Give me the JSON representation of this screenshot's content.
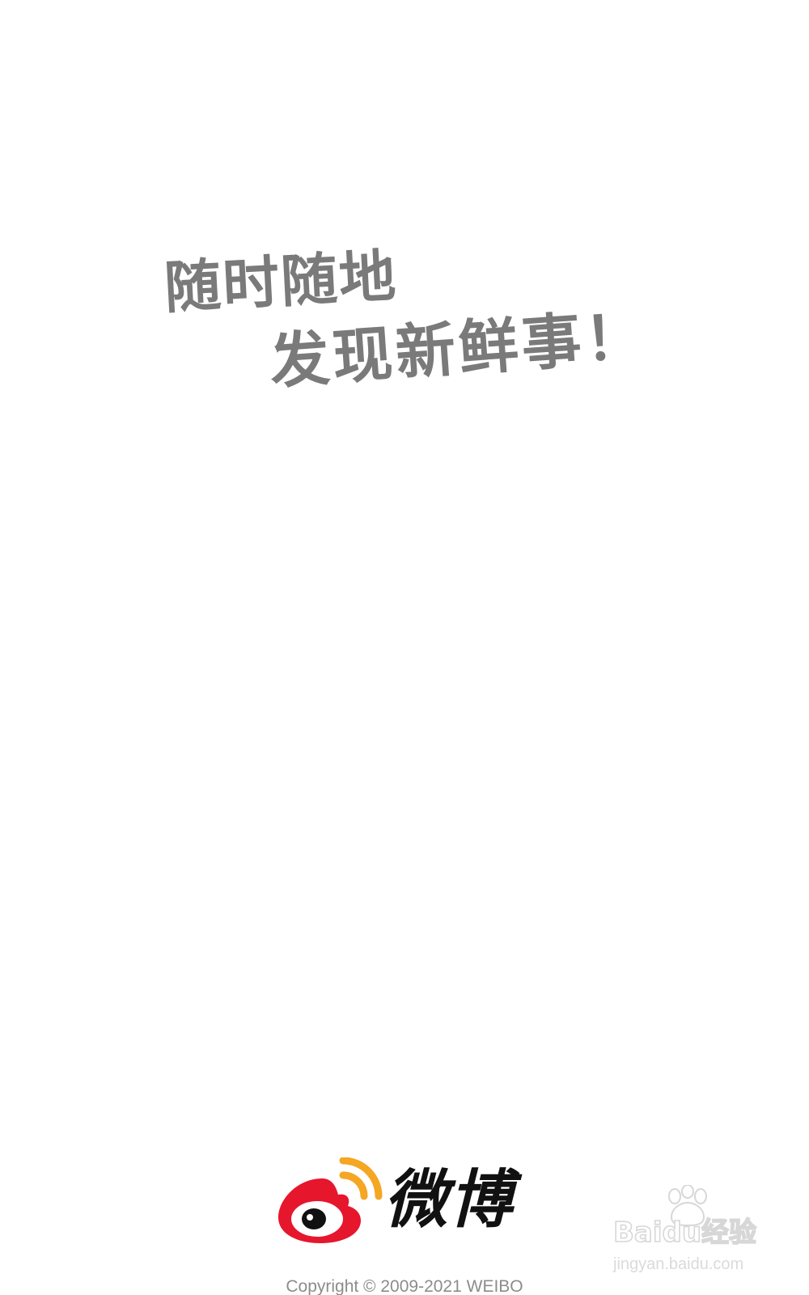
{
  "slogan": {
    "line1": "随时随地",
    "line2": "发现新鲜事！"
  },
  "brand": {
    "logo_icon": "weibo-eye-logo-icon",
    "name": "微博",
    "copyright": "Copyright © 2009-2021 WEIBO"
  },
  "watermark": {
    "icon": "baidu-paw-icon",
    "text": "Baidu经验",
    "url": "jingyan.baidu.com"
  },
  "colors": {
    "background": "#ffffff",
    "slogan": "#7a7a7a",
    "logo_red": "#e6162d",
    "logo_orange": "#f5a623",
    "brand_text": "#111111",
    "copyright": "#8c8c8c"
  }
}
